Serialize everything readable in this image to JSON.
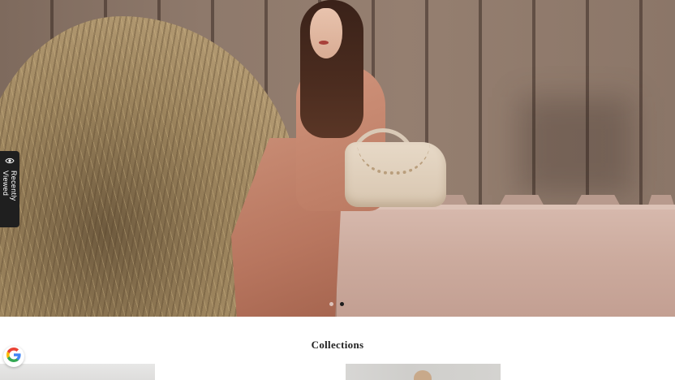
{
  "hero": {
    "carousel": {
      "total_slides": 2,
      "active_index": 1
    }
  },
  "recently_viewed": {
    "label": "Recently Viewed",
    "icon": "eye-icon"
  },
  "collections": {
    "title": "Collections"
  },
  "google_badge": {
    "icon": "google-logo-icon"
  },
  "colors": {
    "tab_background": "#1f1f1f",
    "page_background": "#ffffff",
    "active_dot": "#1d1d1d"
  }
}
